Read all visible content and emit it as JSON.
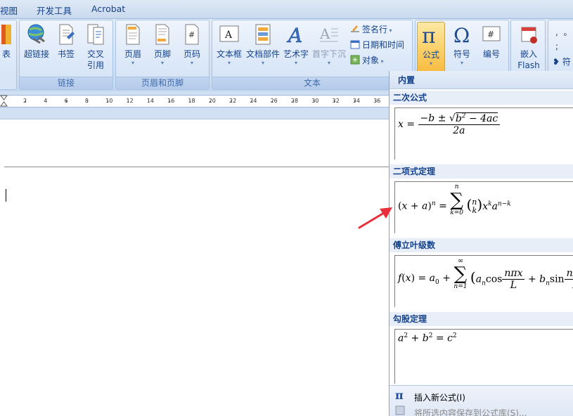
{
  "menu": {
    "tabs": [
      "视图",
      "开发工具",
      "Acrobat"
    ]
  },
  "ribbon": {
    "partial_left_label": "表",
    "groups": {
      "links": {
        "label": "链接",
        "buttons": [
          "超链接",
          "书签",
          "交叉引用"
        ]
      },
      "header_footer": {
        "label": "页眉和页脚",
        "buttons": [
          "页眉",
          "页脚",
          "页码"
        ]
      },
      "text": {
        "label": "文本",
        "buttons": [
          "文本框",
          "文档部件",
          "艺术字",
          "首字下沉"
        ],
        "small_buttons": [
          "签名行",
          "日期和时间",
          "对象"
        ]
      },
      "symbols": {
        "buttons": [
          "公式",
          "符号",
          "编号"
        ],
        "embed_flash": "嵌入 Flash",
        "partial_right_label": "符"
      }
    }
  },
  "ruler": {
    "numbers": [
      "2",
      "4",
      "6",
      "8",
      "10",
      "12",
      "14",
      "16",
      "18",
      "20",
      "22",
      "24",
      "26",
      "28",
      "30",
      "32",
      "34",
      "36"
    ]
  },
  "gallery": {
    "header": "内置",
    "sections": [
      {
        "title": "二次公式"
      },
      {
        "title": "二项式定理"
      },
      {
        "title": "傅立叶级数"
      },
      {
        "title": "勾股定理"
      }
    ],
    "footer": {
      "insert_new": "插入新公式(I)",
      "save_selection": "将所选内容保存到公式库(S)..."
    }
  },
  "colors": {
    "ribbon_text": "#15428b",
    "active_button": "#fbd16a",
    "arrow": "#e8303a"
  }
}
